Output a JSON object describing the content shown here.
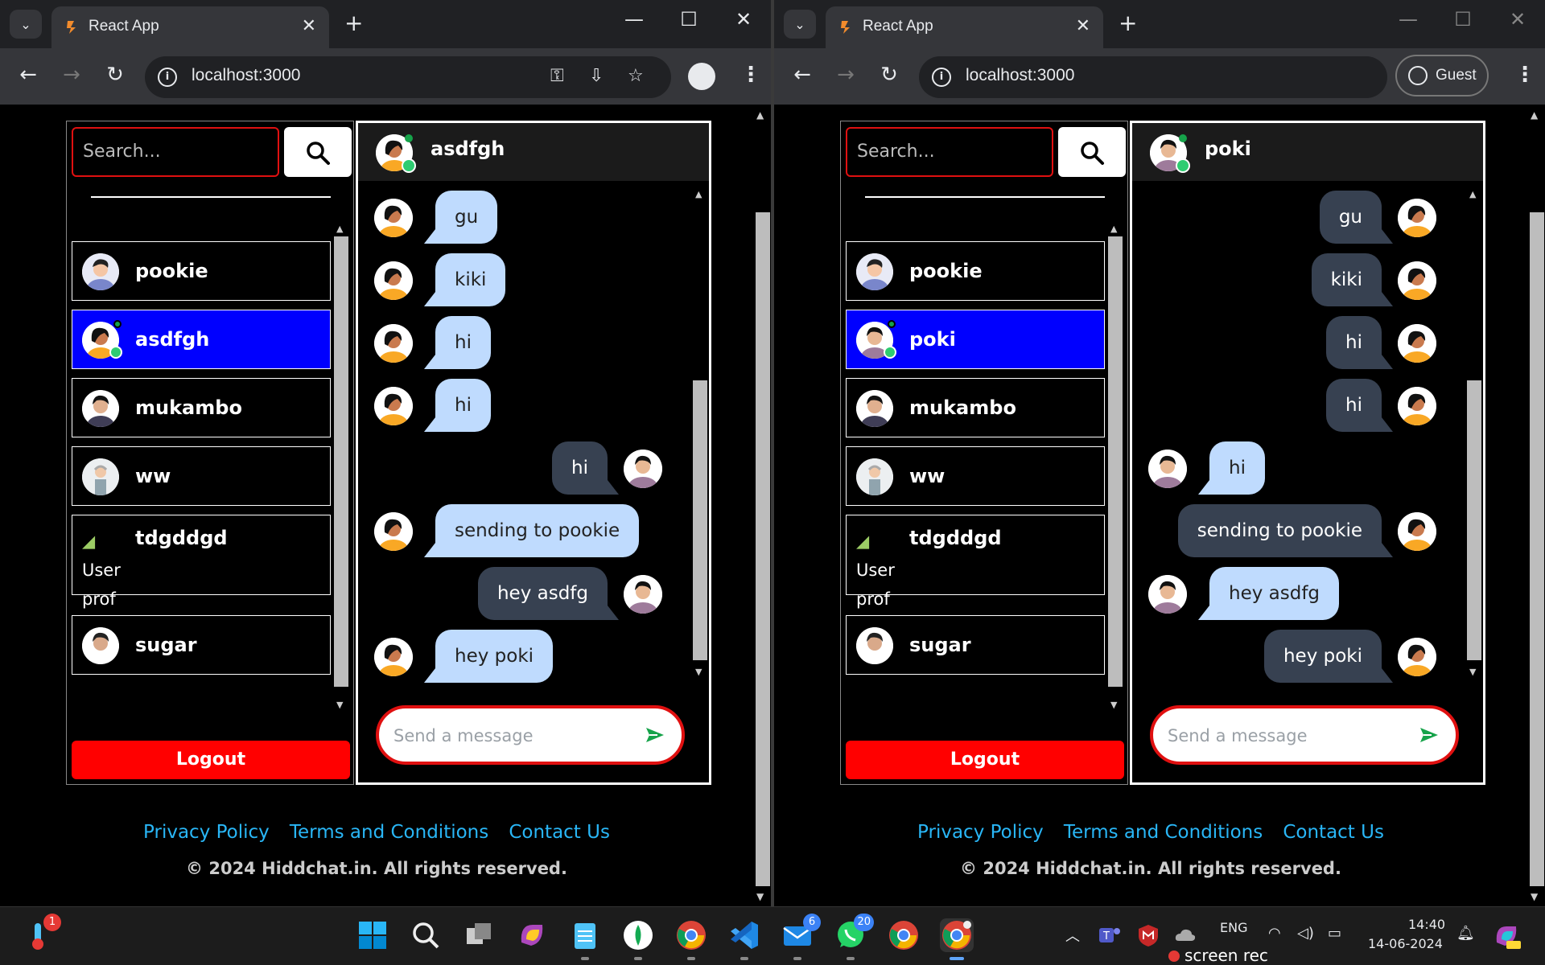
{
  "browser_left": {
    "tab_title": "React App",
    "url": "localhost:3000"
  },
  "browser_right": {
    "tab_title": "React App",
    "url": "localhost:3000",
    "guest_label": "Guest"
  },
  "left_app": {
    "search_placeholder": "Search...",
    "users": [
      {
        "name": "pookie"
      },
      {
        "name": "asdfgh"
      },
      {
        "name": "mukambo"
      },
      {
        "name": "ww"
      },
      {
        "name": "tdgddgd",
        "broken_img_text": "User prof"
      },
      {
        "name": "sugar"
      }
    ],
    "logout_label": "Logout",
    "chat_header_name": "asdfgh",
    "messages": [
      {
        "text": "gu",
        "side": "in"
      },
      {
        "text": "kiki",
        "side": "in"
      },
      {
        "text": "hi",
        "side": "in"
      },
      {
        "text": "hi",
        "side": "in"
      },
      {
        "text": "hi",
        "side": "out"
      },
      {
        "text": "sending to pookie",
        "side": "in"
      },
      {
        "text": "hey asdfg",
        "side": "out"
      },
      {
        "text": "hey poki",
        "side": "in"
      }
    ],
    "send_placeholder": "Send a message"
  },
  "right_app": {
    "search_placeholder": "Search...",
    "users": [
      {
        "name": "pookie"
      },
      {
        "name": "poki"
      },
      {
        "name": "mukambo"
      },
      {
        "name": "ww"
      },
      {
        "name": "tdgddgd",
        "broken_img_text": "User prof"
      },
      {
        "name": "sugar"
      }
    ],
    "logout_label": "Logout",
    "chat_header_name": "poki",
    "messages": [
      {
        "text": "gu",
        "side": "out"
      },
      {
        "text": "kiki",
        "side": "out"
      },
      {
        "text": "hi",
        "side": "out"
      },
      {
        "text": "hi",
        "side": "out"
      },
      {
        "text": "hi",
        "side": "in"
      },
      {
        "text": "sending to pookie",
        "side": "out"
      },
      {
        "text": "hey asdfg",
        "side": "in"
      },
      {
        "text": "hey poki",
        "side": "out"
      }
    ],
    "send_placeholder": "Send a message"
  },
  "footer": {
    "privacy": "Privacy Policy",
    "terms": "Terms and Conditions",
    "contact": "Contact Us",
    "copyright": "© 2024 Hiddchat.in. All rights reserved."
  },
  "taskbar": {
    "weather_badge": "1",
    "mail_badge": "6",
    "whatsapp_badge": "20",
    "lang": "ENG",
    "time": "14:40",
    "date": "14-06-2024",
    "screenrec": "screen rec"
  },
  "colors": {
    "selected_user": "#0000ff",
    "incoming_bubble": "#bfdbfe",
    "outgoing_bubble": "#374151",
    "logout": "#ff0000",
    "footer_link": "#29b6f6"
  }
}
